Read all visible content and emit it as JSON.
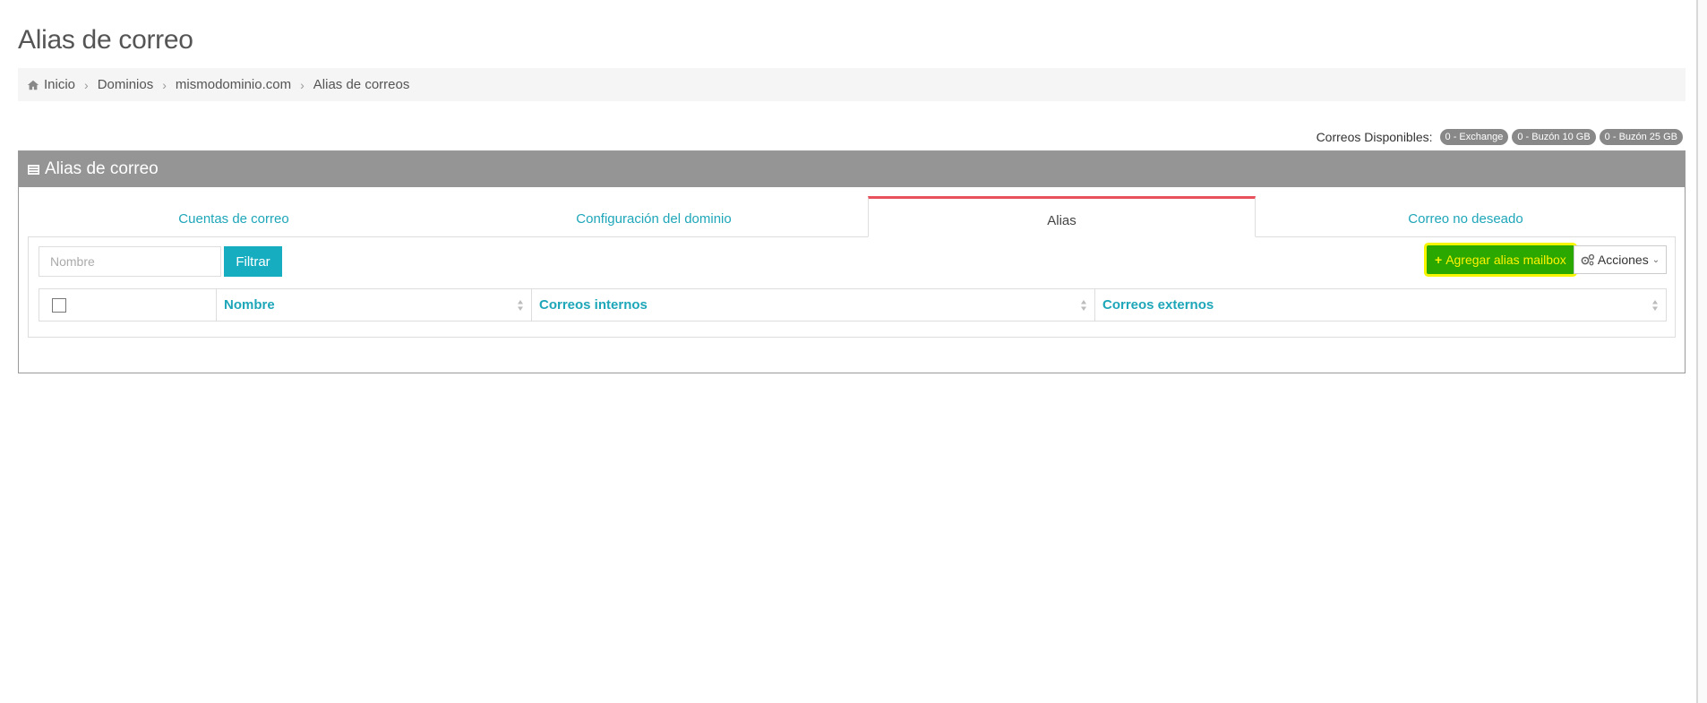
{
  "page": {
    "title": "Alias de correo"
  },
  "breadcrumb": {
    "items": [
      {
        "label": "Inicio"
      },
      {
        "label": "Dominios"
      },
      {
        "label": "mismodominio.com"
      },
      {
        "label": "Alias de correos"
      }
    ]
  },
  "available": {
    "label": "Correos Disponibles:",
    "badges": [
      "0 - Exchange",
      "0 - Buzón 10 GB",
      "0 - Buzón 25 GB"
    ]
  },
  "panel": {
    "title": "Alias de correo"
  },
  "tabs": [
    {
      "label": "Cuentas de correo",
      "active": false
    },
    {
      "label": "Configuración del dominio",
      "active": false
    },
    {
      "label": "Alias",
      "active": true
    },
    {
      "label": "Correo no deseado",
      "active": false
    }
  ],
  "toolbar": {
    "filter_placeholder": "Nombre",
    "filter_value": "",
    "filter_label": "Filtrar",
    "add_label": "Agregar alias mailbox",
    "actions_label": "Acciones"
  },
  "table": {
    "columns": [
      "Nombre",
      "Correos internos",
      "Correos externos"
    ]
  },
  "colors": {
    "accent": "#1ea6b9",
    "active_tab_border": "#e8505b",
    "panel_header": "#959595",
    "add_button_bg": "#2aa800",
    "highlight": "#f7f500"
  },
  "icons": {
    "breadcrumb_home": "home-icon",
    "panel": "list-icon",
    "add": "plus-icon",
    "actions": "gears-icon",
    "dropdown": "chevron-down-icon",
    "sort": "sort-icon"
  }
}
